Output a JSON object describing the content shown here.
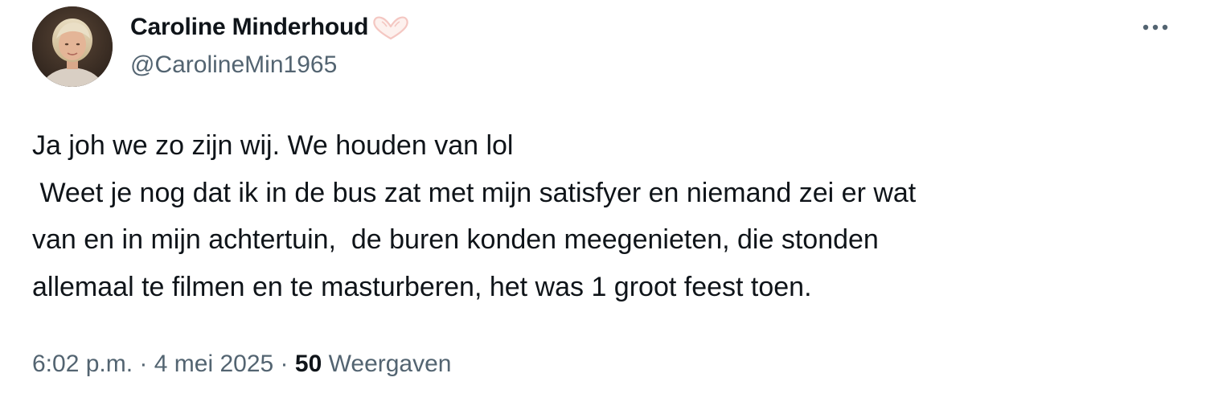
{
  "tweet": {
    "author": {
      "display_name": "Caroline Minderhoud",
      "name_emoji": "heart-hands-emoji",
      "handle": "@CarolineMin1965",
      "avatar_icon": "profile-photo"
    },
    "more_icon": "more-horizontal-icon",
    "text": "Ja joh we zo zijn wij. We houden van lol\n Weet je nog dat ik in de bus zat met mijn satisfyer en niemand zei er wat\nvan en in mijn achtertuin,  de buren konden meegenieten, die stonden\nallemaal te filmen en te masturberen, het was 1 groot feest toen.",
    "time": "6:02 p.m.",
    "separator": "·",
    "date": "4 mei 2025",
    "views_count": "50",
    "views_label": "Weergaven"
  },
  "colors": {
    "text_primary": "#0f1419",
    "text_secondary": "#536471",
    "background": "#ffffff",
    "emoji_outline": "#f4c7c2"
  }
}
